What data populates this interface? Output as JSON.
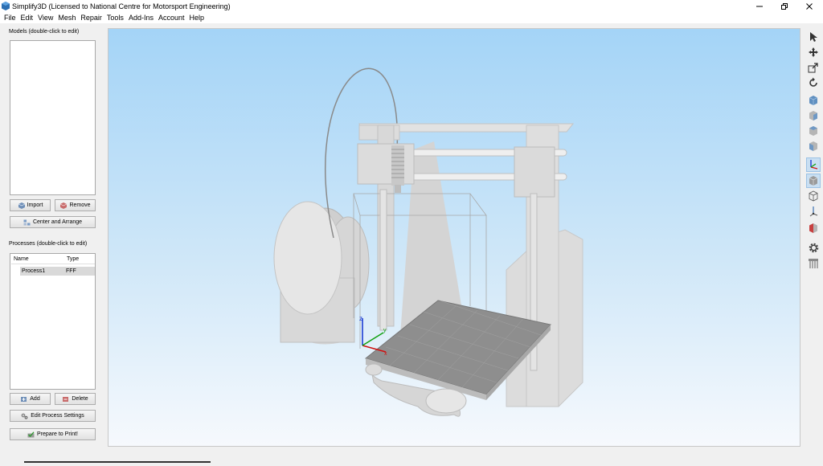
{
  "window": {
    "title": "Simplify3D (Licensed to National Centre for Motorsport Engineering)",
    "controls": [
      "minimize-icon",
      "restore-icon",
      "close-icon"
    ]
  },
  "menu": {
    "items": [
      "File",
      "Edit",
      "View",
      "Mesh",
      "Repair",
      "Tools",
      "Add-Ins",
      "Account",
      "Help"
    ]
  },
  "models": {
    "label": "Models (double-click to edit)",
    "import_label": "Import",
    "remove_label": "Remove",
    "center_label": "Center and Arrange"
  },
  "processes": {
    "label": "Processes (double-click to edit)",
    "columns": [
      "Name",
      "Type"
    ],
    "rows": [
      {
        "name": "Process1",
        "type": "FFF"
      }
    ],
    "add_label": "Add",
    "delete_label": "Delete",
    "edit_label": "Edit Process Settings",
    "prepare_label": "Prepare to Print!"
  },
  "viewport": {
    "axes": [
      "z",
      "x",
      "y"
    ],
    "axis_colors": {
      "x": "#d01010",
      "y": "#10a010",
      "z": "#1030d0"
    }
  },
  "toolbar": {
    "tools": [
      "select-icon",
      "move-icon",
      "scale-icon",
      "rotate-icon",
      "view-default-icon",
      "view-front-icon",
      "view-top-icon",
      "view-side-icon",
      "axes-icon",
      "solid-view-icon",
      "wireframe-view-icon",
      "origin-icon",
      "cross-section-icon",
      "settings-gear-icon",
      "support-structures-icon"
    ]
  }
}
